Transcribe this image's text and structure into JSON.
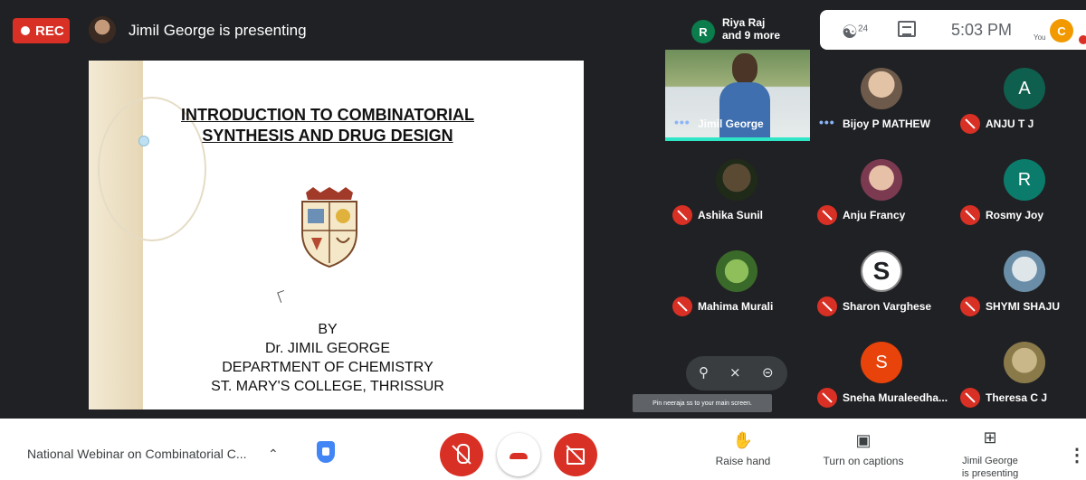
{
  "topbar": {
    "rec_label": "REC",
    "presenting_text": "Jimil George is presenting"
  },
  "header": {
    "participants_badge": "R",
    "participants_name": "Riya Raj",
    "participants_more": "and 9 more",
    "people_count": "24",
    "time": "5:03 PM",
    "self_label": "You",
    "self_initial": "C"
  },
  "slide": {
    "title_line1": "INTRODUCTION  TO COMBINATORIAL",
    "title_line2": "SYNTHESIS AND DRUG DESIGN",
    "by": "BY",
    "author": "Dr. JIMIL GEORGE",
    "department": "DEPARTMENT OF CHEMISTRY",
    "college": "ST. MARY'S COLLEGE, THRISSUR"
  },
  "participants": [
    {
      "name": "Jimil George",
      "type": "video",
      "mic": "active"
    },
    {
      "name": "Bijoy P MATHEW",
      "type": "photo",
      "mic": "active"
    },
    {
      "name": "ANJU T J",
      "type": "initial",
      "initial": "A",
      "color": "#0f5f4f",
      "mic": "muted"
    },
    {
      "name": "Ashika Sunil",
      "type": "photo",
      "mic": "muted"
    },
    {
      "name": "Anju Francy",
      "type": "photo",
      "mic": "muted"
    },
    {
      "name": "Rosmy Joy",
      "type": "initial",
      "initial": "R",
      "color": "#0b7c6b",
      "mic": "muted"
    },
    {
      "name": "Mahima Murali",
      "type": "photo",
      "mic": "muted"
    },
    {
      "name": "Sharon Varghese",
      "type": "photo",
      "initial": "S",
      "mic": "muted"
    },
    {
      "name": "SHYMI SHAJU",
      "type": "photo",
      "mic": "muted"
    },
    {
      "name": "",
      "type": "hover",
      "mic": "muted"
    },
    {
      "name": "Sneha Muraleedha...",
      "type": "initial",
      "initial": "S",
      "color": "#e8430a",
      "mic": "muted"
    },
    {
      "name": "Theresa C J",
      "type": "photo",
      "mic": "muted"
    }
  ],
  "tooltip": "Pin neeraja ss to your main screen.",
  "bottom": {
    "meeting_title": "National Webinar on Combinatorial C...",
    "raise_hand": "Raise hand",
    "captions": "Turn on captions",
    "presenting_line1": "Jimil George",
    "presenting_line2": "is presenting"
  }
}
